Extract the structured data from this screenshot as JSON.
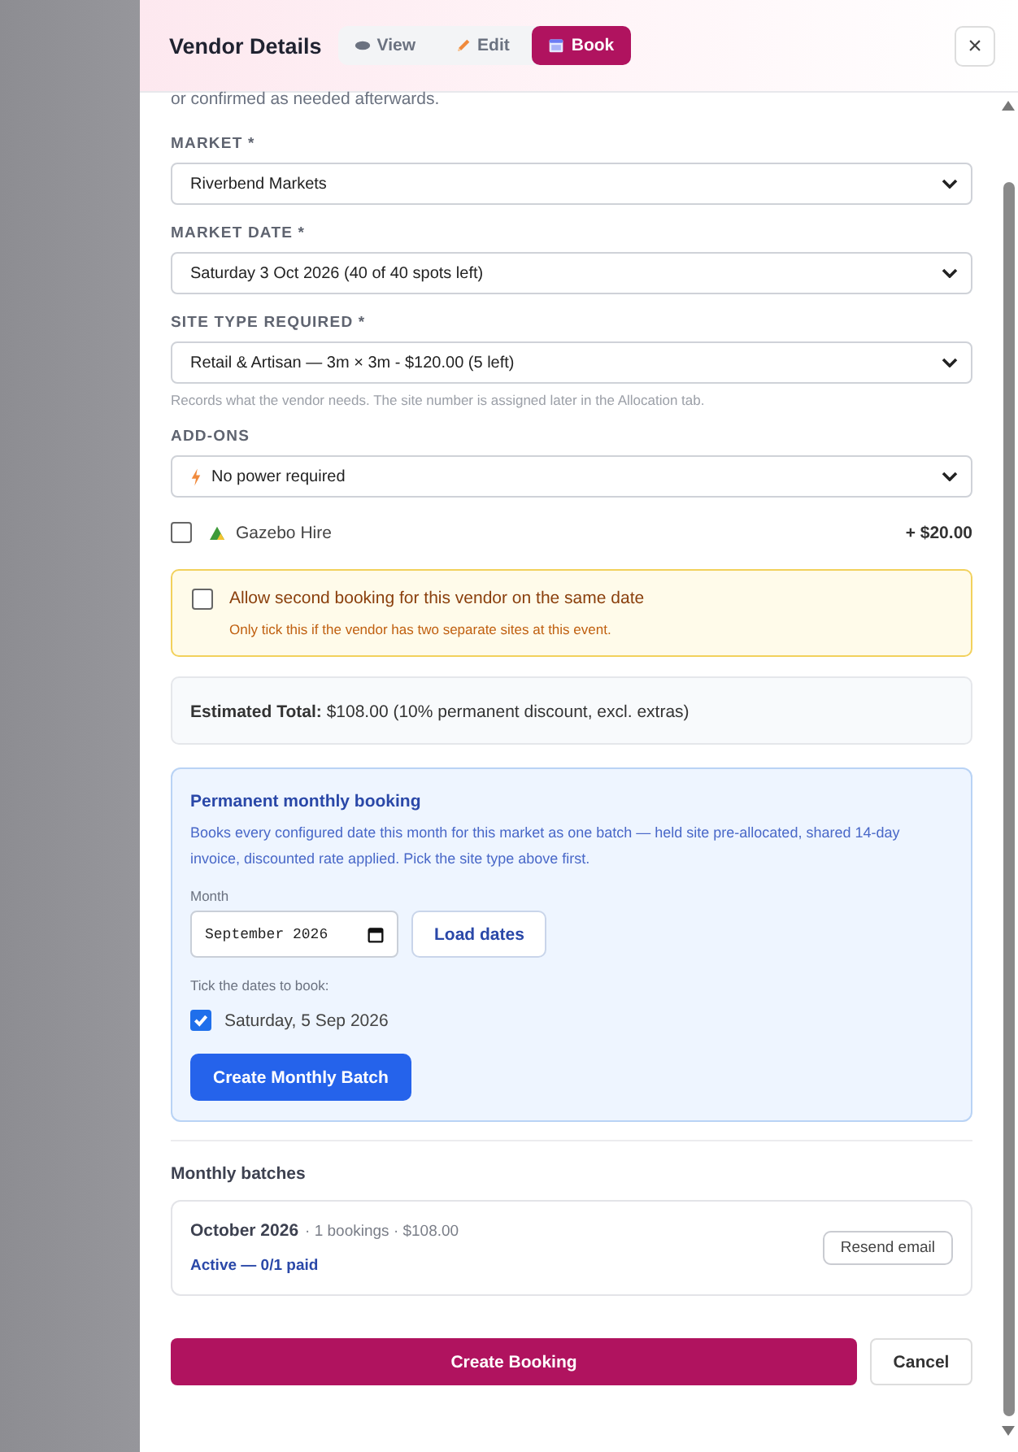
{
  "header": {
    "title": "Vendor Details",
    "tabs": [
      {
        "label": "View",
        "kind": "view",
        "selected": false
      },
      {
        "label": "Edit",
        "kind": "edit",
        "selected": false
      },
      {
        "label": "Book",
        "kind": "book",
        "selected": true
      }
    ],
    "close": "×"
  },
  "intro_text": "or confirmed as needed afterwards.",
  "fields": [
    {
      "label": "MARKET *",
      "value": "Riverbend Markets"
    },
    {
      "label": "MARKET DATE *",
      "value": "Saturday 3 Oct 2026 (40 of 40 spots left)"
    },
    {
      "label": "SITE TYPE REQUIRED *",
      "value": "Retail & Artisan — 3m × 3m - $120.00 (5 left)",
      "hint": "Records what the vendor needs. The site number is assigned later in the Allocation tab."
    },
    {
      "label": "ADD-ONS",
      "value": "No power required",
      "kind": "power"
    }
  ],
  "extras": [
    {
      "label": "Gazebo Hire",
      "price": "+ $20.00",
      "checked": false
    }
  ],
  "second_booking": {
    "label": "Allow second booking for this vendor on the same date",
    "note": "Only tick this if the vendor has two separate sites at this event.",
    "checked": false
  },
  "estimate": "**Estimated Total:** $108.00 (10% permanent discount, excl. extras)",
  "monthly": {
    "title": "Permanent monthly booking",
    "description": "Books every configured date this month for this market as one batch — held site pre-allocated, shared 14-day invoice, discounted rate applied. Pick the site type above first.",
    "month_label": "Month",
    "month_value": "September 2026",
    "load_button": "Load dates",
    "dates_label": "Tick the dates to book:",
    "dates": [
      {
        "label": "Saturday, 5 Sep 2026",
        "checked": true
      }
    ],
    "create_button": "Create Monthly Batch"
  },
  "batches": {
    "title": "Monthly batches",
    "items": [
      {
        "month": "October 2026",
        "details": "· 1 bookings · $108.00",
        "status": "Active — 0/1 paid",
        "action": "Resend email"
      }
    ]
  },
  "footer": {
    "primary": "Create Booking",
    "cancel": "Cancel"
  }
}
